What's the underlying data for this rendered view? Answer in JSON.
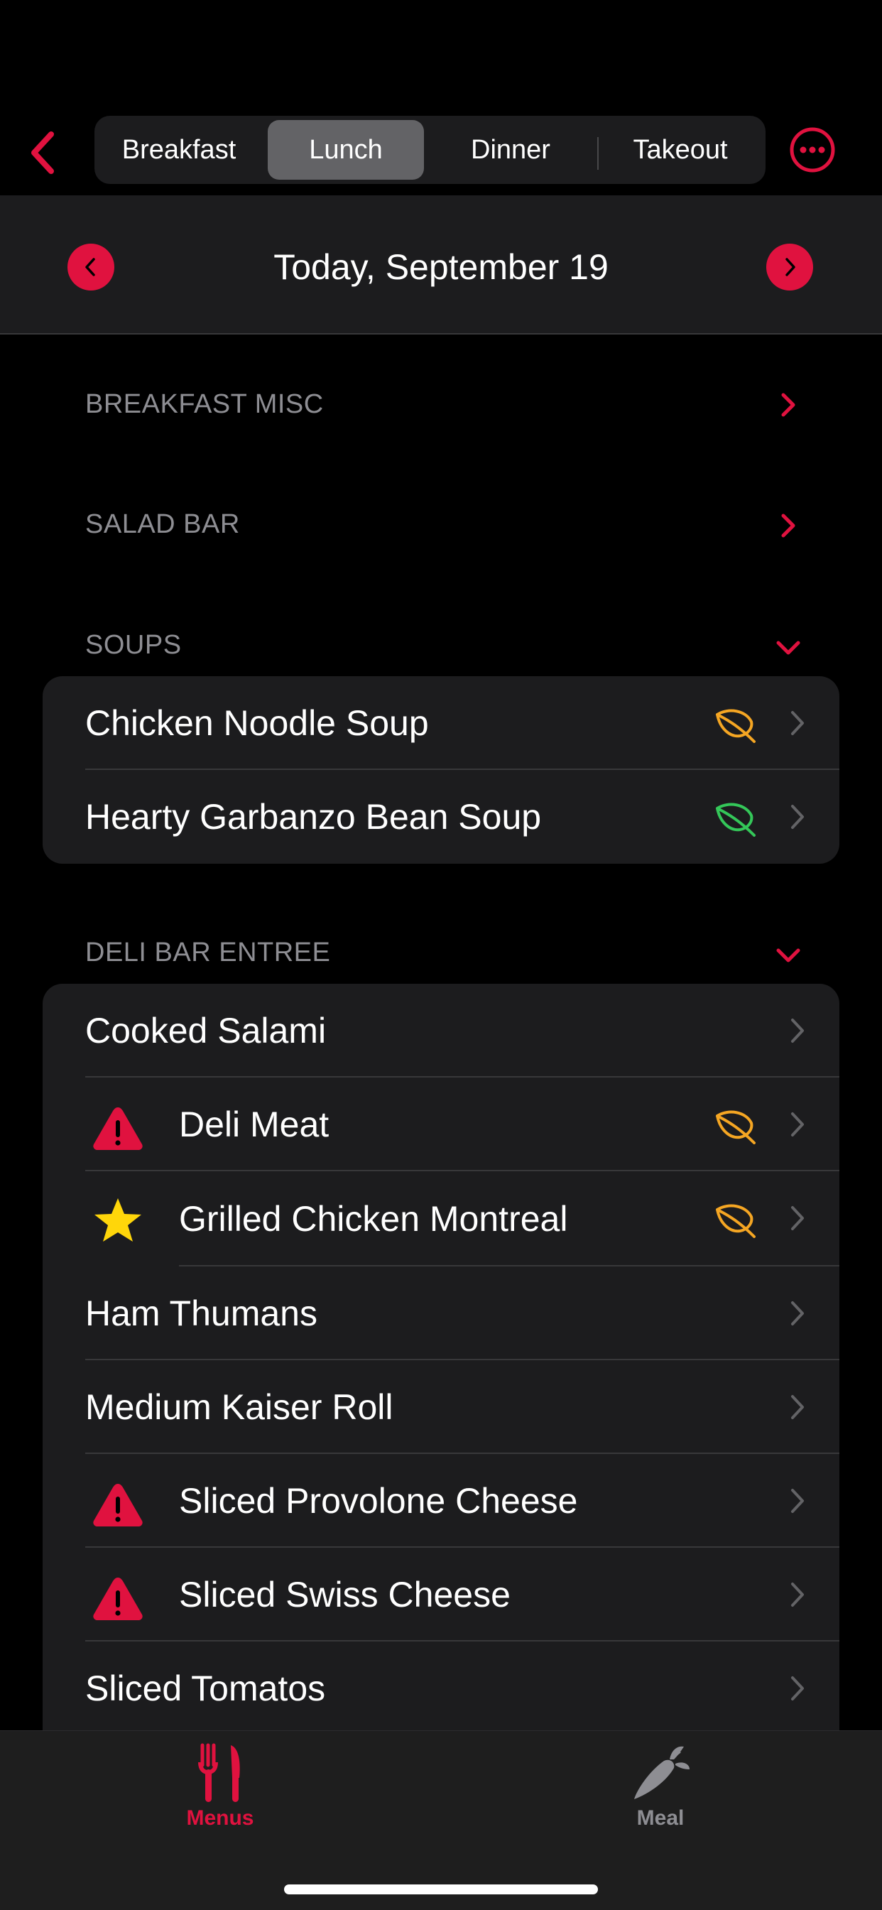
{
  "segments": [
    {
      "label": "Breakfast"
    },
    {
      "label": "Lunch"
    },
    {
      "label": "Dinner"
    },
    {
      "label": "Takeout"
    }
  ],
  "selected_segment": "Lunch",
  "date": {
    "title": "Today, September 19"
  },
  "sections": {
    "breakfast_misc": {
      "title": "BREAKFAST MISC"
    },
    "salad_bar": {
      "title": "SALAD BAR"
    },
    "soups": {
      "title": "SOUPS",
      "items": [
        {
          "name": "Chicken Noodle Soup",
          "leaf": "orange"
        },
        {
          "name": "Hearty Garbanzo Bean Soup",
          "leaf": "green"
        }
      ]
    },
    "deli": {
      "title": "DELI BAR ENTREE",
      "items": [
        {
          "name": "Cooked Salami"
        },
        {
          "name": "Deli Meat",
          "lead": "warning",
          "leaf": "orange"
        },
        {
          "name": "Grilled Chicken Montreal",
          "lead": "star",
          "leaf": "orange"
        },
        {
          "name": "Ham Thumans"
        },
        {
          "name": "Medium Kaiser Roll"
        },
        {
          "name": "Sliced Provolone Cheese",
          "lead": "warning"
        },
        {
          "name": "Sliced Swiss Cheese",
          "lead": "warning"
        },
        {
          "name": "Sliced Tomatos"
        }
      ]
    }
  },
  "tabbar": {
    "menus": {
      "label": "Menus",
      "icon": "fork-knife-icon"
    },
    "meal": {
      "label": "Meal",
      "icon": "carrot-icon"
    }
  },
  "colors": {
    "accent": "#e0123f",
    "leaf_orange": "#f5a623",
    "leaf_green": "#34c759",
    "star": "#ffd60a",
    "tab_inactive": "#8e8e93"
  }
}
